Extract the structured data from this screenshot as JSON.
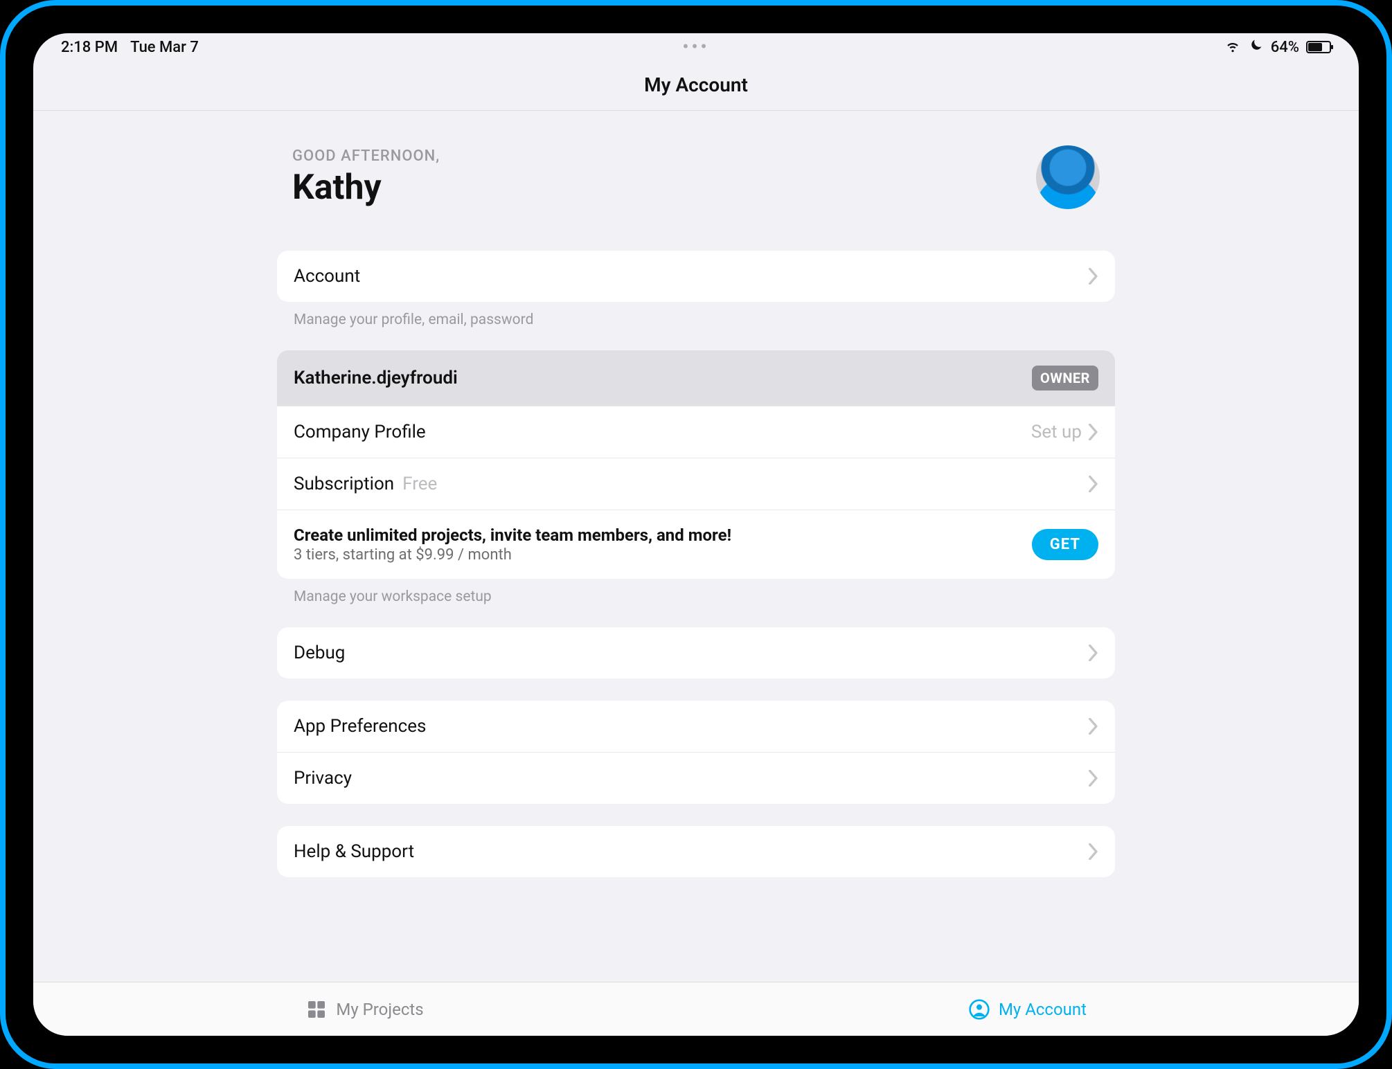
{
  "status": {
    "time": "2:18 PM",
    "date": "Tue Mar 7",
    "battery_pct": "64%",
    "battery_fill": 64
  },
  "nav": {
    "title": "My Account"
  },
  "greeting": {
    "label": "GOOD AFTERNOON,",
    "name": "Kathy"
  },
  "account_section": {
    "title": "Account",
    "footer": "Manage your profile, email, password"
  },
  "workspace": {
    "name": "Katherine.djeyfroudi",
    "badge": "OWNER",
    "company_label": "Company Profile",
    "company_right": "Set up",
    "subscription_label": "Subscription",
    "subscription_value": "Free",
    "promo_title": "Create unlimited projects, invite team members, and more!",
    "promo_sub": "3 tiers, starting at $9.99 / month",
    "get_label": "GET",
    "footer": "Manage your workspace setup"
  },
  "debug": {
    "label": "Debug"
  },
  "prefs": {
    "app_label": "App Preferences",
    "privacy_label": "Privacy"
  },
  "help": {
    "label": "Help & Support"
  },
  "tabs": {
    "projects": "My Projects",
    "account": "My Account"
  }
}
